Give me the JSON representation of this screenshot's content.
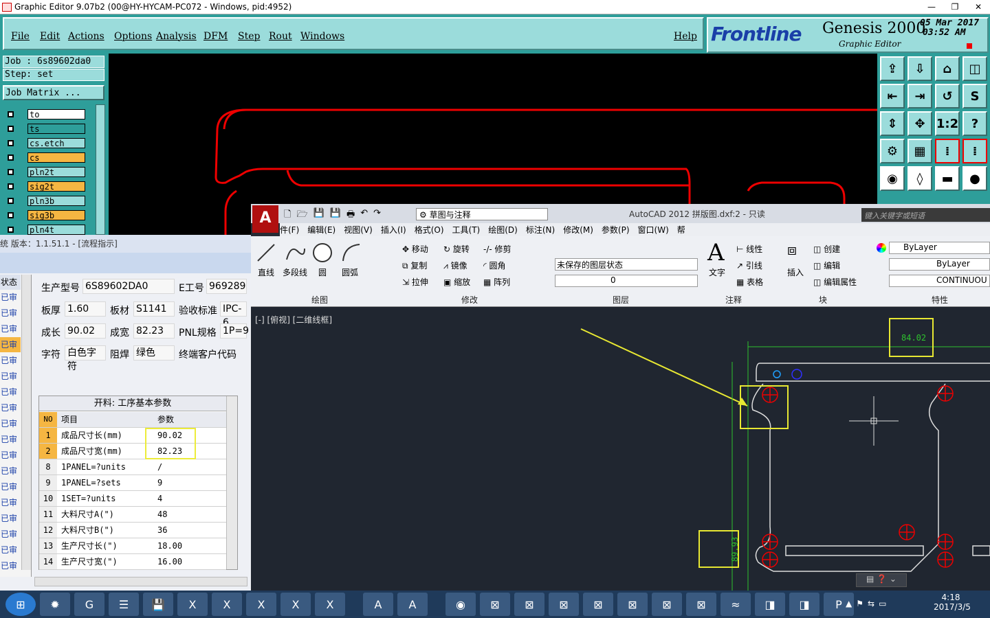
{
  "genesis": {
    "title": "Graphic Editor 9.07b2 (00@HY-HYCAM-PC072 - Windows, pid:4952)",
    "menu": [
      "File",
      "Edit",
      "Actions",
      "Options",
      "Analysis",
      "DFM",
      "Step",
      "Rout",
      "Windows"
    ],
    "help": "Help",
    "logo": "Frontline",
    "product": "Genesis 2000",
    "subtitle": "Graphic Editor",
    "date": "05 Mar 2017",
    "time": "03:52  AM",
    "job": "Job  : 6s89602da0",
    "step": "Step: set",
    "job_matrix": "Job Matrix ...",
    "layers": [
      {
        "name": "to",
        "color": "#ffffff"
      },
      {
        "name": "ts",
        "color": "#2e9e9a"
      },
      {
        "name": "cs.etch",
        "color": "#9bdcdb"
      },
      {
        "name": "cs",
        "color": "#f5b642"
      },
      {
        "name": "pln2t",
        "color": "#9bdcdb"
      },
      {
        "name": "sig2t",
        "color": "#f5b642"
      },
      {
        "name": "pln3b",
        "color": "#9bdcdb"
      },
      {
        "name": "sig3b",
        "color": "#f5b642"
      },
      {
        "name": "pln4t",
        "color": "#9bdcdb"
      }
    ],
    "tool_icons": [
      "zoom-home-icon",
      "zoom-in-icon",
      "home-icon",
      "window-icon",
      "snap-left-icon",
      "snap-right-icon",
      "undo-icon",
      "s-icon",
      "fit-icon",
      "pan-icon",
      "ratio-icon",
      "help-icon",
      "measure-icon",
      "grid-icon",
      "layer-a-icon",
      "layer-b-icon",
      "circle-icon",
      "shape-icon",
      "ruler-icon",
      "dot-icon"
    ],
    "ratio_label": "1:2"
  },
  "erp": {
    "title": "统  版本：1.1.51.1 - [流程指示]",
    "status_header": "状态",
    "status_items": [
      "已审",
      "已审",
      "已审",
      "已审",
      "已审",
      "已审",
      "已审",
      "已审",
      "已审",
      "已审",
      "已审",
      "已审",
      "已审",
      "已审",
      "已审",
      "已审",
      "已审",
      "已审"
    ],
    "fields": {
      "model_label": "生产型号",
      "model": "6S89602DA0",
      "eno_label": "E工号",
      "eno": "969289",
      "thick_label": "板厚",
      "thick": "1.60",
      "mat_label": "板材",
      "mat": "S1141",
      "std_label": "验收标准",
      "std": "IPC-6",
      "len_label": "成长",
      "len": "90.02",
      "wid_label": "成宽",
      "wid": "82.23",
      "pnl_label": "PNL规格",
      "pnl": "1P=9",
      "char_label": "字符",
      "char": "白色字符",
      "mask_label": "阻焊",
      "mask": "绿色",
      "cust_label": "终端客户代码"
    },
    "grid": {
      "caption": "开料: 工序基本参数",
      "headers": [
        "NO",
        "项目",
        "参数"
      ],
      "rows": [
        [
          "1",
          "成品尺寸长(mm)",
          "90.02"
        ],
        [
          "2",
          "成品尺寸宽(mm)",
          "82.23"
        ],
        [
          "8",
          "1PANEL=?units",
          "/"
        ],
        [
          "9",
          "1PANEL=?sets",
          "9"
        ],
        [
          "10",
          "1SET=?units",
          "4"
        ],
        [
          "11",
          "大料尺寸A(\")",
          "48"
        ],
        [
          "12",
          "大料尺寸B(\")",
          "36"
        ],
        [
          "13",
          "生产尺寸长(\")",
          "18.00"
        ],
        [
          "14",
          "生产尺寸宽(\")",
          "16.00"
        ]
      ]
    }
  },
  "acad": {
    "title": "AutoCAD 2012    拼版图.dxf:2 - 只读",
    "workspace": "草图与注释",
    "search_placeholder": "键入关键字或短语",
    "menu": [
      "件(F)",
      "编辑(E)",
      "视图(V)",
      "插入(I)",
      "格式(O)",
      "工具(T)",
      "绘图(D)",
      "标注(N)",
      "修改(M)",
      "参数(P)",
      "窗口(W)",
      "帮"
    ],
    "draw_tools": [
      "直线",
      "多段线",
      "圆",
      "圆弧"
    ],
    "modify_tools": [
      "移动",
      "旋转",
      "修剪",
      "复制",
      "镜像",
      "圆角",
      "拉伸",
      "缩放",
      "阵列"
    ],
    "layer_state": "未保存的图层状态",
    "layer_current": "0",
    "text_tool": "文字",
    "annot_tools": [
      "线性",
      "引线",
      "表格"
    ],
    "insert_tool": "插入",
    "block_tools": [
      "创建",
      "编辑",
      "编辑属性"
    ],
    "props": [
      "ByLayer",
      "ByLayer",
      "CONTINUOU"
    ],
    "panels": [
      "绘图",
      "修改",
      "图层",
      "注释",
      "块",
      "特性"
    ],
    "viewport_label": "[-] [俯视] [二维线框]",
    "dim_top": "84.02",
    "dim_left": "89.93"
  },
  "taskbar": {
    "time": "4:18",
    "date": "2017/3/5",
    "apps": [
      "start-icon",
      "app-star-icon",
      "app-g-icon",
      "app-doc-icon",
      "save-icon",
      "excel-icon",
      "excel-icon",
      "excel-icon",
      "excel-icon",
      "excel-icon",
      "autocad-icon",
      "autocad-icon",
      "eye-icon",
      "genesis-icon",
      "genesis-icon",
      "genesis-icon",
      "genesis-icon",
      "genesis-icon",
      "genesis-icon",
      "genesis-icon",
      "fish-icon",
      "glass-icon",
      "glass-icon",
      "p-icon"
    ]
  }
}
